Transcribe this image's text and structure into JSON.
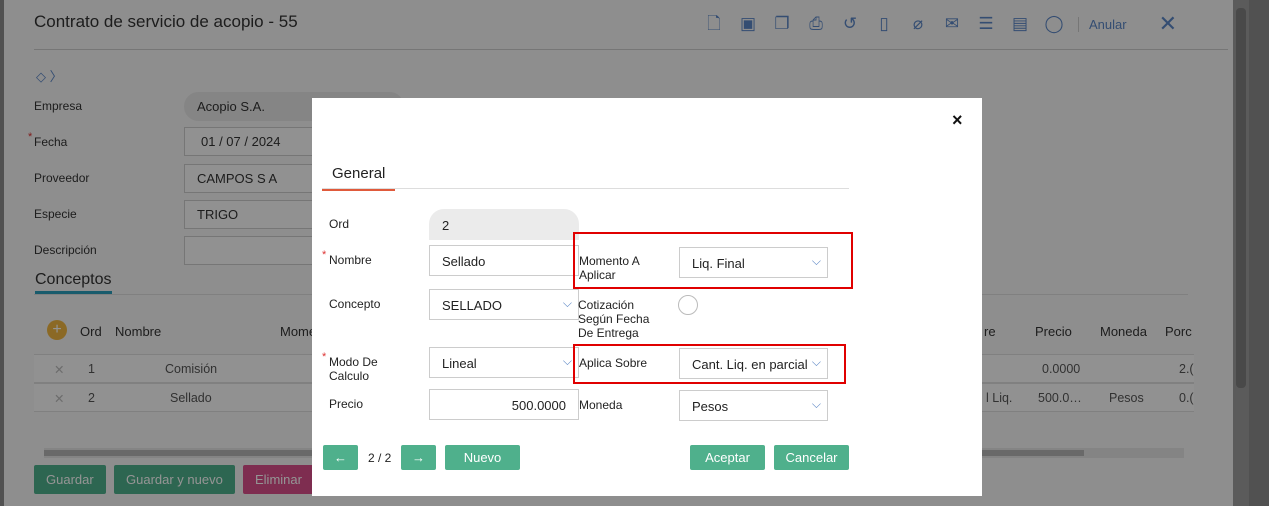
{
  "background": {
    "title": "Contrato de servicio de acopio - 55",
    "toolbar_icons": [
      "new-doc-icon",
      "save-icon",
      "copy-icon",
      "print-icon",
      "history-icon",
      "pdf-icon",
      "attach-icon",
      "mail-icon",
      "checklist-icon",
      "notes-icon",
      "comment-icon"
    ],
    "anular_label": "Anular",
    "fields": {
      "empresa_label": "Empresa",
      "empresa_value": "Acopio S.A.",
      "fecha_label": "Fecha",
      "fecha_value": "01 / 07 / 2024",
      "proveedor_label": "Proveedor",
      "proveedor_value": "CAMPOS S A",
      "especie_label": "Especie",
      "especie_value": "TRIGO",
      "descripcion_label": "Descripción"
    },
    "conceptos_title": "Conceptos",
    "grid": {
      "headers": {
        "ord": "Ord",
        "nombre": "Nombre",
        "momento": "Mome",
        "sobre": "re",
        "precio": "Precio",
        "moneda": "Moneda",
        "porc": "Porc"
      },
      "rows": [
        {
          "ord": "1",
          "nombre": "Comisión",
          "sobre": "",
          "precio": "0.0000",
          "moneda": "",
          "porc": "2.("
        },
        {
          "ord": "2",
          "nombre": "Sellado",
          "sobre": "l Liq.",
          "precio": "500.0…",
          "moneda": "Pesos",
          "porc": "0.("
        }
      ]
    },
    "buttons": {
      "guardar": "Guardar",
      "guardar_nuevo": "Guardar y nuevo",
      "eliminar": "Eliminar"
    }
  },
  "modal": {
    "close": "×",
    "tab_general": "General",
    "ord_label": "Ord",
    "ord_value": "2",
    "nombre_label": "Nombre",
    "nombre_value": "Sellado",
    "concepto_label": "Concepto",
    "concepto_value": "SELLADO",
    "modo_label": "Modo De Calculo",
    "modo_value": "Lineal",
    "precio_label": "Precio",
    "precio_value": "500.0000",
    "momento_label": "Momento A Aplicar",
    "momento_value": "Liq. Final",
    "cotizacion_label": "Cotización Según Fecha De Entrega",
    "aplica_label": "Aplica Sobre",
    "aplica_value": "Cant. Liq. en parcial",
    "moneda_label": "Moneda",
    "moneda_value": "Pesos",
    "pager": "2 / 2",
    "prev": "←",
    "next": "→",
    "nuevo": "Nuevo",
    "aceptar": "Aceptar",
    "cancelar": "Cancelar",
    "highlight_color": "#e00000",
    "button_color": "#4fb08c"
  }
}
